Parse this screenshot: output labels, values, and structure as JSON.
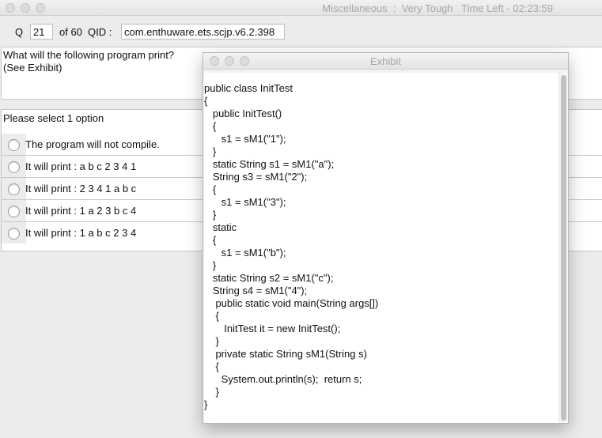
{
  "window": {
    "title": "Miscellaneous  :  Very Tough   Time Left - 02:23:59"
  },
  "question_bar": {
    "q_label": "Q",
    "q_number": "21",
    "of_label": "of 60",
    "qid_label": "QID :",
    "qid_value": "com.enthuware.ets.scjp.v6.2.398"
  },
  "question": {
    "lines": [
      "What will the following program print?",
      "(See Exhibit)"
    ]
  },
  "options": {
    "title": "Please select 1 option",
    "items": [
      {
        "label": "The program will not compile."
      },
      {
        "label": "It will print : a b c 2 3 4 1"
      },
      {
        "label": "It will print : 2 3 4 1 a b c"
      },
      {
        "label": "It will print : 1 a 2 3 b c 4"
      },
      {
        "label": "It will print : 1 a b c 2 3 4"
      }
    ]
  },
  "exhibit": {
    "title": "Exhibit",
    "code_lines": [
      "public class InitTest",
      "{",
      "   public InitTest()",
      "   {",
      "      s1 = sM1(\"1\");",
      "   }",
      "   static String s1 = sM1(\"a\");",
      "   String s3 = sM1(\"2\");",
      "   {",
      "      s1 = sM1(\"3\");",
      "   }",
      "   static",
      "   {",
      "      s1 = sM1(\"b\");",
      "   }",
      "   static String s2 = sM1(\"c\");",
      "   String s4 = sM1(\"4\");",
      "    public static void main(String args[])",
      "    {",
      "       InitTest it = new InitTest();",
      "    }",
      "    private static String sM1(String s)",
      "    {",
      "      System.out.println(s);  return s;",
      "    }",
      "}"
    ]
  }
}
